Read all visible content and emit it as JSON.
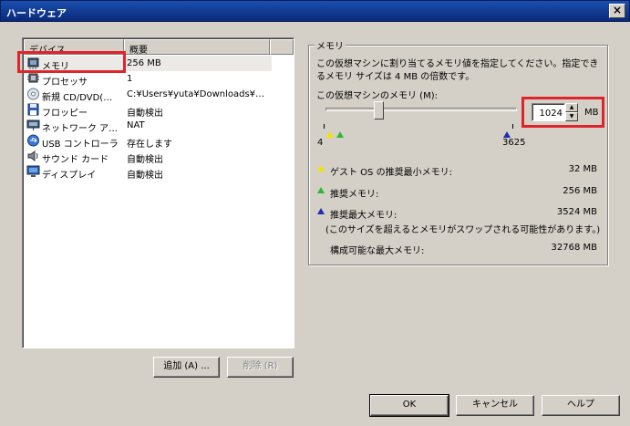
{
  "window": {
    "title": "ハードウェア",
    "close_glyph": "×"
  },
  "device_list": {
    "columns": [
      "デバイス",
      "概要"
    ],
    "rows": [
      {
        "icon": "memory-icon",
        "device": "メモリ",
        "summary": "256 MB",
        "selected": true
      },
      {
        "icon": "processor-icon",
        "device": "プロセッサ",
        "summary": "1"
      },
      {
        "icon": "cd-dvd-icon",
        "device": "新規 CD/DVD(…",
        "summary": "C:¥Users¥yuta¥Downloads¥…"
      },
      {
        "icon": "floppy-icon",
        "device": "フロッピー",
        "summary": "自動検出"
      },
      {
        "icon": "network-adapter-icon",
        "device": "ネットワーク ア…",
        "summary": "NAT"
      },
      {
        "icon": "usb-controller-icon",
        "device": "USB コントローラ",
        "summary": "存在します"
      },
      {
        "icon": "sound-card-icon",
        "device": "サウンド カード",
        "summary": "自動検出"
      },
      {
        "icon": "display-icon",
        "device": "ディスプレイ",
        "summary": "自動検出"
      }
    ]
  },
  "list_buttons": {
    "add": "追加 (A) ...",
    "remove": "削除 (R)"
  },
  "memory": {
    "group_title": "メモリ",
    "description_line1": "この仮想マシンに割り当てるメモリ値を指定してください。指定でき",
    "description_line2": "るメモリ サイズは 4 MB の倍数です。",
    "field_label": "この仮想マシンのメモリ (M):",
    "value": "1024",
    "unit": "MB",
    "slider": {
      "min_label": "4",
      "max_label": "3625",
      "min": 4,
      "max": 3625,
      "value": 1024
    },
    "legend": {
      "guest_min_label": "ゲスト OS の推奨最小メモリ:",
      "guest_min_value": "32 MB",
      "recommended_label": "推奨メモリ:",
      "recommended_value": "256 MB",
      "max_recommended_label": "推奨最大メモリ:",
      "max_recommended_value": "3524 MB",
      "swap_note": "(このサイズを超えるとメモリがスワップされる可能性があります。)",
      "max_configurable_label": "構成可能な最大メモリ:",
      "max_configurable_value": "32768 MB"
    },
    "colors": {
      "yellow": "#f2e400",
      "green": "#2fb82f",
      "blue": "#1f2fb0"
    }
  },
  "dialog_buttons": {
    "ok": "OK",
    "cancel": "キャンセル",
    "help": "ヘルプ"
  },
  "highlight_color": "#e0242c"
}
